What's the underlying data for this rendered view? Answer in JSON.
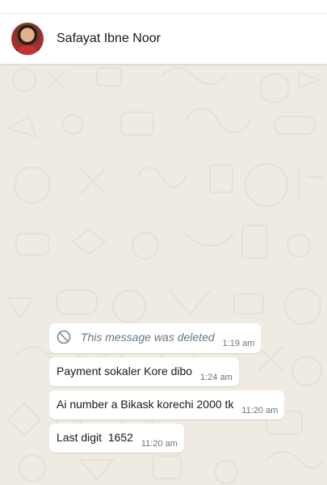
{
  "header": {
    "contact_name": "Safayat Ibne Noor"
  },
  "messages": [
    {
      "text": "This message was deleted",
      "time": "1:19 am",
      "deleted": true
    },
    {
      "text": "Payment sokaler Kore dibo",
      "time": "1:24 am"
    },
    {
      "text": "Ai number a Bikask korechi 2000 tk",
      "time": "11:20 am"
    },
    {
      "text": "Last digit  1652",
      "time": "11:20 am"
    }
  ],
  "colors": {
    "chat_bg": "#efeae2",
    "bubble_bg": "#ffffff",
    "meta_text": "#667781"
  }
}
